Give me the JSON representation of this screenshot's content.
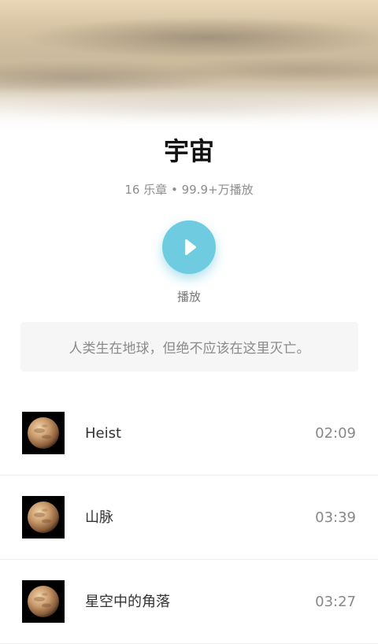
{
  "album": {
    "title": "宇宙",
    "subtitle": "16 乐章 • 99.9+万播放",
    "play_label": "播放",
    "description": "人类生在地球，但绝不应该在这里灭亡。"
  },
  "theme": {
    "accent": "#6fcbe0"
  },
  "icons": {
    "play": "play-icon",
    "cover": "planet-mars-icon"
  },
  "tracks": [
    {
      "name": "Heist",
      "duration": "02:09"
    },
    {
      "name": "山脉",
      "duration": "03:39"
    },
    {
      "name": "星空中的角落",
      "duration": "03:27"
    }
  ]
}
